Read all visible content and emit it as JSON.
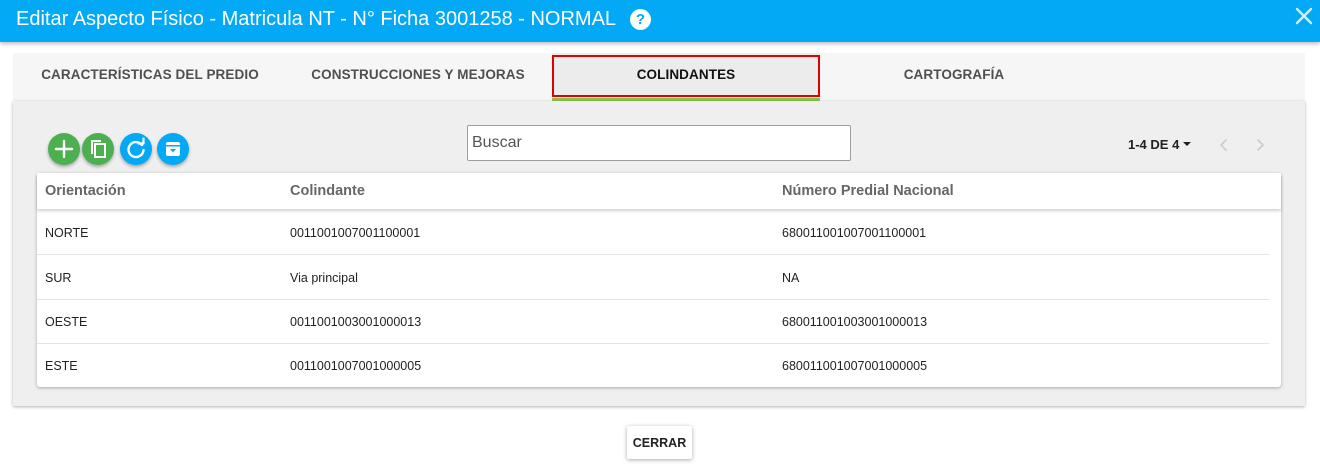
{
  "header": {
    "title": "Editar Aspecto Físico - Matricula NT - N° Ficha 3001258 - NORMAL",
    "help_icon_label": "?"
  },
  "tabs": [
    {
      "label": "CARACTERÍSTICAS DEL PREDIO",
      "active": false
    },
    {
      "label": "CONSTRUCCIONES Y MEJORAS",
      "active": false
    },
    {
      "label": "COLINDANTES",
      "active": true
    },
    {
      "label": "CARTOGRAFÍA",
      "active": false
    }
  ],
  "toolbar": {
    "search_placeholder": "Buscar",
    "icons": [
      "add-icon",
      "copy-icon",
      "refresh-icon",
      "archive-icon"
    ]
  },
  "paginator": {
    "range_label": "1-4 DE 4"
  },
  "table": {
    "columns": [
      "Orientación",
      "Colindante",
      "Número Predial Nacional"
    ],
    "rows": [
      [
        "NORTE",
        "0011001007001100001",
        "680011001007001100001"
      ],
      [
        "SUR",
        "Via principal",
        "NA"
      ],
      [
        "OESTE",
        "0011001003001000013",
        "680011001003001000013"
      ],
      [
        "ESTE",
        "0011001007001000005",
        "680011001007001000005"
      ]
    ]
  },
  "footer": {
    "close_label": "CERRAR"
  },
  "colors": {
    "header_bg": "#03a9f4",
    "tab_underline": "#8bc34a",
    "highlight_border": "#e00000",
    "add_button": "#4caf50",
    "action_button": "#03a9f4"
  }
}
